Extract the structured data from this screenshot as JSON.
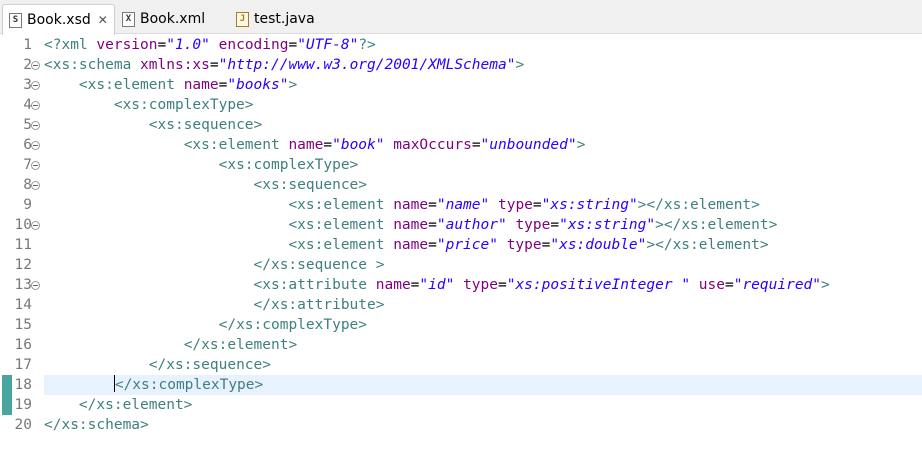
{
  "tabs": [
    {
      "label": "Book.xsd",
      "icon": "xsd-file-icon",
      "icon_glyph": "S",
      "active": true,
      "close": "✕"
    },
    {
      "label": "Book.xml",
      "icon": "xml-file-icon",
      "icon_glyph": "X",
      "active": false
    },
    {
      "label": "test.java",
      "icon": "java-file-icon",
      "icon_glyph": "J",
      "active": false
    }
  ],
  "editor": {
    "current_line": 18,
    "lines": [
      {
        "n": "1",
        "fold": false,
        "segs": [
          [
            "pi",
            "<?xml"
          ],
          [
            "t",
            " "
          ],
          [
            "at",
            "version"
          ],
          [
            "t",
            "="
          ],
          [
            "vl",
            "\"1.0\""
          ],
          [
            "t",
            " "
          ],
          [
            "at",
            "encoding"
          ],
          [
            "t",
            "="
          ],
          [
            "vl",
            "\"UTF-8\""
          ],
          [
            "pi",
            "?>"
          ]
        ]
      },
      {
        "n": "2",
        "fold": true,
        "segs": [
          [
            "tg",
            "<xs:schema"
          ],
          [
            "t",
            " "
          ],
          [
            "at",
            "xmlns:xs"
          ],
          [
            "t",
            "="
          ],
          [
            "vl",
            "\"http://www.w3.org/2001/XMLSchema\""
          ],
          [
            "tg",
            ">"
          ]
        ]
      },
      {
        "n": "3",
        "fold": true,
        "segs": [
          [
            "t",
            "    "
          ],
          [
            "tg",
            "<xs:element"
          ],
          [
            "t",
            " "
          ],
          [
            "at",
            "name"
          ],
          [
            "t",
            "="
          ],
          [
            "vl",
            "\"books\""
          ],
          [
            "tg",
            ">"
          ]
        ]
      },
      {
        "n": "4",
        "fold": true,
        "segs": [
          [
            "t",
            "        "
          ],
          [
            "tg",
            "<xs:complexType>"
          ]
        ]
      },
      {
        "n": "5",
        "fold": true,
        "segs": [
          [
            "t",
            "            "
          ],
          [
            "tg",
            "<xs:sequence>"
          ]
        ]
      },
      {
        "n": "6",
        "fold": true,
        "segs": [
          [
            "t",
            "                "
          ],
          [
            "tg",
            "<xs:element"
          ],
          [
            "t",
            " "
          ],
          [
            "at",
            "name"
          ],
          [
            "t",
            "="
          ],
          [
            "vl",
            "\"book\""
          ],
          [
            "t",
            " "
          ],
          [
            "at",
            "maxOccurs"
          ],
          [
            "t",
            "="
          ],
          [
            "vl",
            "\"unbounded\""
          ],
          [
            "tg",
            ">"
          ]
        ]
      },
      {
        "n": "7",
        "fold": true,
        "segs": [
          [
            "t",
            "                    "
          ],
          [
            "tg",
            "<xs:complexType>"
          ]
        ]
      },
      {
        "n": "8",
        "fold": true,
        "segs": [
          [
            "t",
            "                        "
          ],
          [
            "tg",
            "<xs:sequence>"
          ]
        ]
      },
      {
        "n": "9",
        "fold": false,
        "segs": [
          [
            "t",
            "                            "
          ],
          [
            "tg",
            "<xs:element"
          ],
          [
            "t",
            " "
          ],
          [
            "at",
            "name"
          ],
          [
            "t",
            "="
          ],
          [
            "vl",
            "\"name\""
          ],
          [
            "t",
            " "
          ],
          [
            "at",
            "type"
          ],
          [
            "t",
            "="
          ],
          [
            "vl",
            "\"xs:string\""
          ],
          [
            "tg",
            "></xs:element>"
          ]
        ]
      },
      {
        "n": "10",
        "fold": true,
        "segs": [
          [
            "t",
            "                            "
          ],
          [
            "tg",
            "<xs:element"
          ],
          [
            "t",
            " "
          ],
          [
            "at",
            "name"
          ],
          [
            "t",
            "="
          ],
          [
            "vl",
            "\"author\""
          ],
          [
            "t",
            " "
          ],
          [
            "at",
            "type"
          ],
          [
            "t",
            "="
          ],
          [
            "vl",
            "\"xs:string\""
          ],
          [
            "tg",
            "></xs:element>"
          ]
        ]
      },
      {
        "n": "11",
        "fold": false,
        "segs": [
          [
            "t",
            "                            "
          ],
          [
            "tg",
            "<xs:element"
          ],
          [
            "t",
            " "
          ],
          [
            "at",
            "name"
          ],
          [
            "t",
            "="
          ],
          [
            "vl",
            "\"price\""
          ],
          [
            "t",
            " "
          ],
          [
            "at",
            "type"
          ],
          [
            "t",
            "="
          ],
          [
            "vl",
            "\"xs:double\""
          ],
          [
            "tg",
            "></xs:element>"
          ]
        ]
      },
      {
        "n": "12",
        "fold": false,
        "segs": [
          [
            "t",
            "                        "
          ],
          [
            "tg",
            "</xs:sequence >"
          ]
        ]
      },
      {
        "n": "13",
        "fold": true,
        "segs": [
          [
            "t",
            "                        "
          ],
          [
            "tg",
            "<xs:attribute"
          ],
          [
            "t",
            " "
          ],
          [
            "at",
            "name"
          ],
          [
            "t",
            "="
          ],
          [
            "vl",
            "\"id\""
          ],
          [
            "t",
            " "
          ],
          [
            "at",
            "type"
          ],
          [
            "t",
            "="
          ],
          [
            "vl",
            "\"xs:positiveInteger \""
          ],
          [
            "t",
            " "
          ],
          [
            "at",
            "use"
          ],
          [
            "t",
            "="
          ],
          [
            "vl",
            "\"required\""
          ],
          [
            "tg",
            ">"
          ]
        ]
      },
      {
        "n": "14",
        "fold": false,
        "segs": [
          [
            "t",
            "                        "
          ],
          [
            "tg",
            "</xs:attribute>"
          ]
        ]
      },
      {
        "n": "15",
        "fold": false,
        "segs": [
          [
            "t",
            "                    "
          ],
          [
            "tg",
            "</xs:complexType>"
          ]
        ]
      },
      {
        "n": "16",
        "fold": false,
        "segs": [
          [
            "t",
            "                "
          ],
          [
            "tg",
            "</xs:element>"
          ]
        ]
      },
      {
        "n": "17",
        "fold": false,
        "segs": [
          [
            "t",
            "            "
          ],
          [
            "tg",
            "</xs:sequence>"
          ]
        ]
      },
      {
        "n": "18",
        "fold": false,
        "segs": [
          [
            "t",
            "        "
          ],
          [
            "caret",
            ""
          ],
          [
            "tg",
            "</xs:complexType>"
          ]
        ]
      },
      {
        "n": "19",
        "fold": false,
        "segs": [
          [
            "t",
            "    "
          ],
          [
            "tg",
            "</xs:element>"
          ]
        ]
      },
      {
        "n": "20",
        "fold": false,
        "segs": [
          [
            "tg",
            "</xs:schema>"
          ]
        ]
      }
    ],
    "change_markers": [
      18,
      19
    ]
  },
  "colors": {
    "tag": "#3f7f7f",
    "attribute": "#7f007f",
    "value": "#2a00ff",
    "current_line": "#e8f2fe",
    "change_marker": "#49a5a0"
  }
}
